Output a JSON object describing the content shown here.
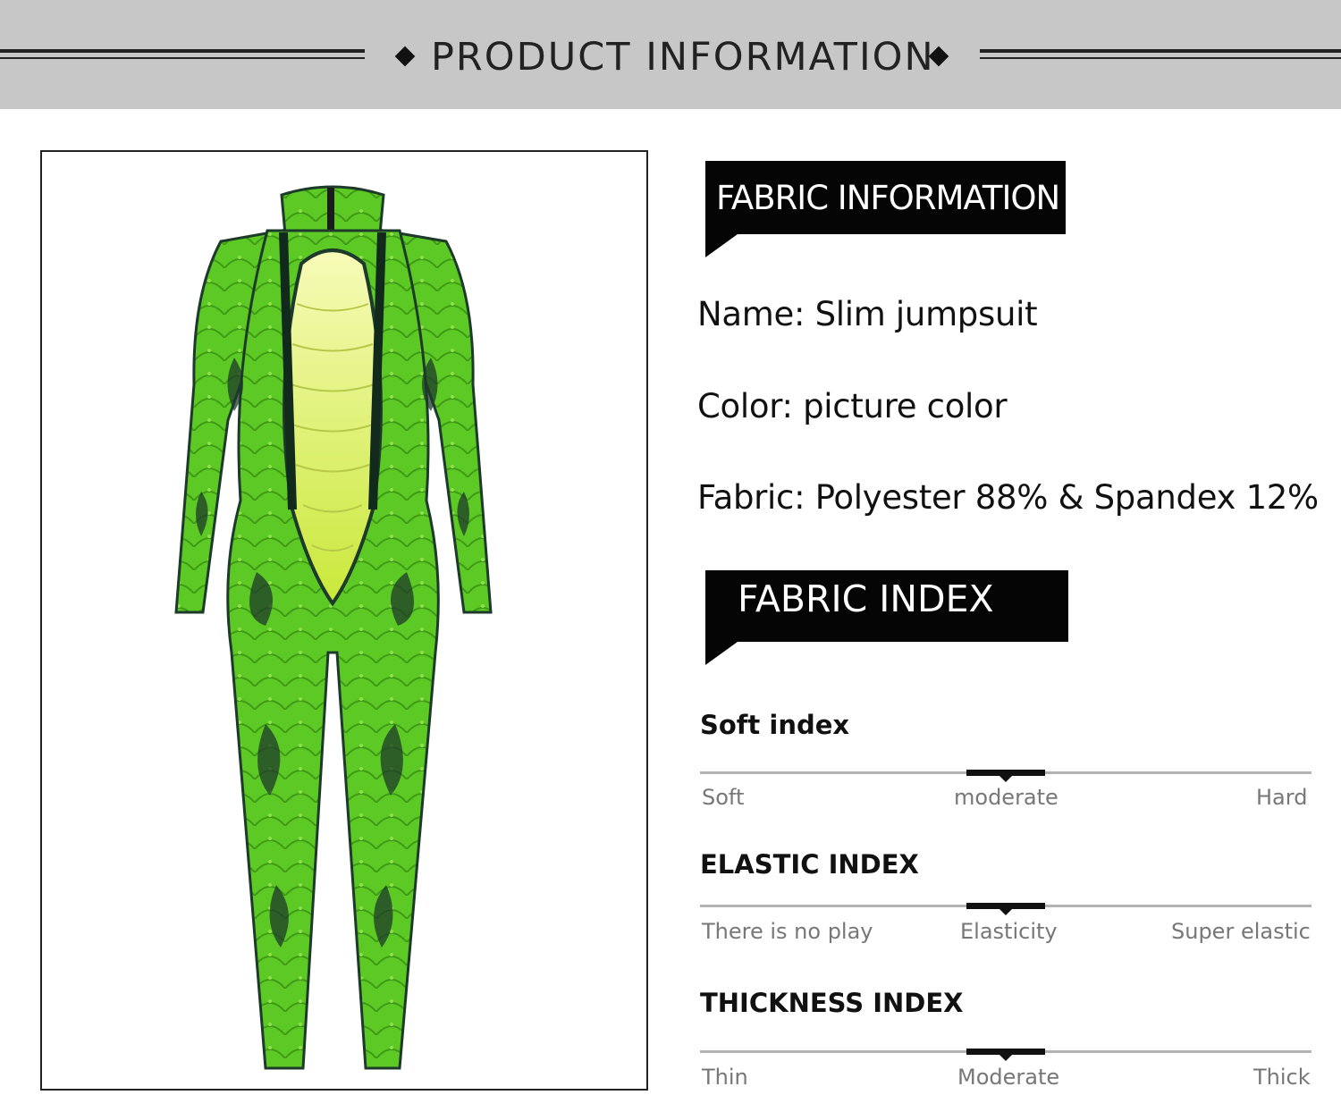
{
  "banner": {
    "title": "PRODUCT INFORMATION"
  },
  "product_image": {
    "description_icon": "green-snake-jumpsuit-image"
  },
  "fabric_information": {
    "heading": "FABRIC INFORMATION",
    "name": "Name:  Slim jumpsuit",
    "color": "Color:  picture color",
    "fabric": "Fabric: Polyester 88% & Spandex 12%"
  },
  "fabric_index": {
    "heading": "FABRIC INDEX",
    "soft": {
      "title": "Soft index",
      "labels": [
        "Soft",
        "moderate",
        "Hard"
      ],
      "level": 0.5
    },
    "elastic": {
      "title": "ELASTIC INDEX",
      "labels": [
        "There is no play",
        "Elasticity",
        "Super elastic"
      ],
      "level": 0.5
    },
    "thickness": {
      "title": "THICKNESS INDEX",
      "labels": [
        "Thin",
        "Moderate",
        "Thick"
      ],
      "level": 0.5
    }
  },
  "colors": {
    "banner": "#c7c7c7",
    "suit_green": "#56c51f",
    "suit_belly": "#f2f7a8",
    "pattern": "#1d3a2a"
  }
}
